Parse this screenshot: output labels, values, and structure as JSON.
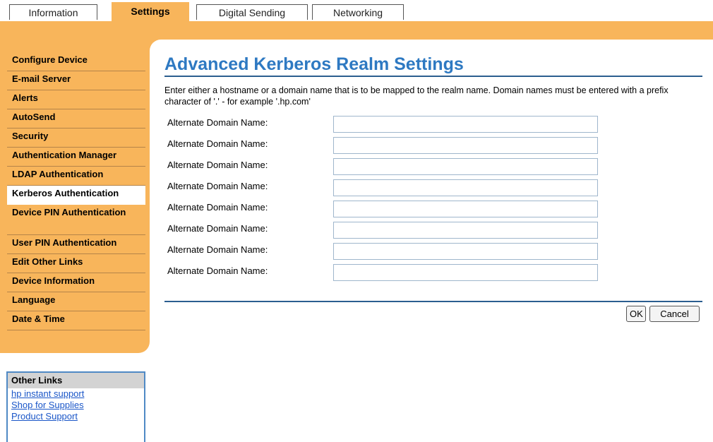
{
  "tabs": {
    "information": "Information",
    "settings": "Settings",
    "digital_sending": "Digital Sending",
    "networking": "Networking"
  },
  "sidebar": {
    "items": [
      "Configure Device",
      "E-mail Server",
      "Alerts",
      "AutoSend",
      "Security",
      "Authentication Manager",
      "LDAP Authentication",
      "Kerberos Authentication",
      "Device PIN Authentication",
      "User PIN Authentication",
      "Edit Other Links",
      "Device Information",
      "Language",
      "Date & Time"
    ],
    "active": "Kerberos Authentication"
  },
  "other_links": {
    "title": "Other Links",
    "links": [
      "hp instant support",
      "Shop for Supplies",
      "Product Support"
    ]
  },
  "main": {
    "title": "Advanced Kerberos Realm Settings",
    "description": "Enter either a hostname or a domain name that is to be mapped to the realm name. Domain names must be entered with a prefix character of '.' - for example '.hp.com'",
    "field_label": "Alternate Domain Name:",
    "fields": [
      "",
      "",
      "",
      "",
      "",
      "",
      "",
      ""
    ]
  },
  "buttons": {
    "ok": "OK",
    "cancel": "Cancel"
  },
  "colors": {
    "accent_orange": "#f8b55b",
    "title_blue": "#2e79c2",
    "rule_blue": "#2b5e8f",
    "link_blue": "#1a56c8"
  }
}
